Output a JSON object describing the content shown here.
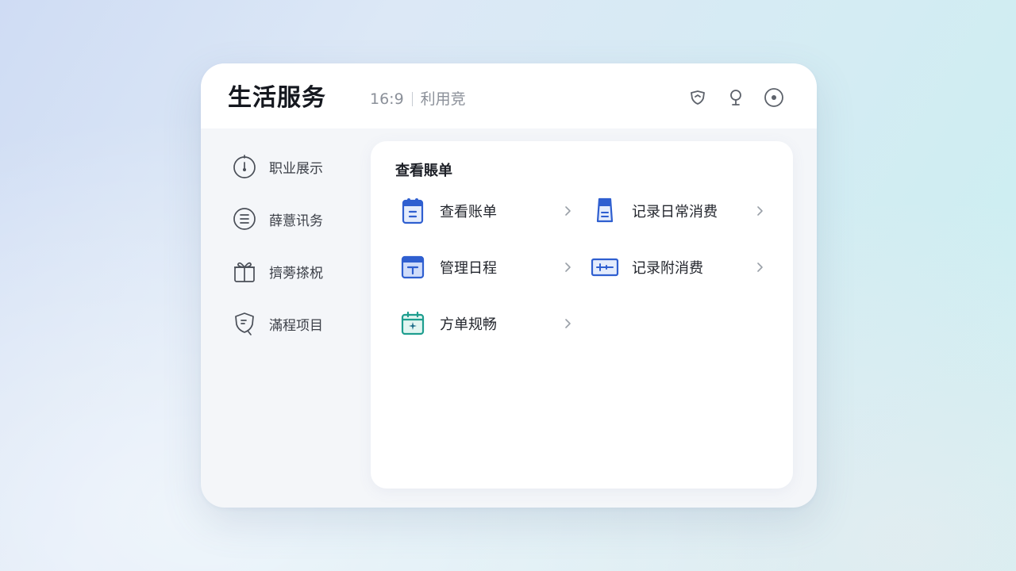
{
  "header": {
    "title": "生活服务",
    "ratio": "16:9",
    "subtitle": "利用竞",
    "icons": [
      "shield-icon",
      "pin-icon",
      "target-icon"
    ]
  },
  "sidebar": {
    "items": [
      {
        "label": "职业展示",
        "icon": "timer-icon"
      },
      {
        "label": "薛薏讯务",
        "icon": "list-icon"
      },
      {
        "label": "擠蒡搽柷",
        "icon": "gift-icon"
      },
      {
        "label": "滿程项目",
        "icon": "chat-shield-icon"
      }
    ]
  },
  "panel": {
    "title": "查看賬单",
    "items": [
      {
        "label": "查看账单",
        "icon": "bill-icon",
        "color": "#2f5fd0"
      },
      {
        "label": "记录日常消费",
        "icon": "receipt-icon",
        "color": "#2f5fd0"
      },
      {
        "label": "管理日程",
        "icon": "schedule-icon",
        "color": "#2f5fd0"
      },
      {
        "label": "记录附消费",
        "icon": "card-icon",
        "color": "#2f5fd0"
      },
      {
        "label": "方单规畅",
        "icon": "calendar-sparkle-icon",
        "color": "#1f9e8f"
      }
    ]
  }
}
